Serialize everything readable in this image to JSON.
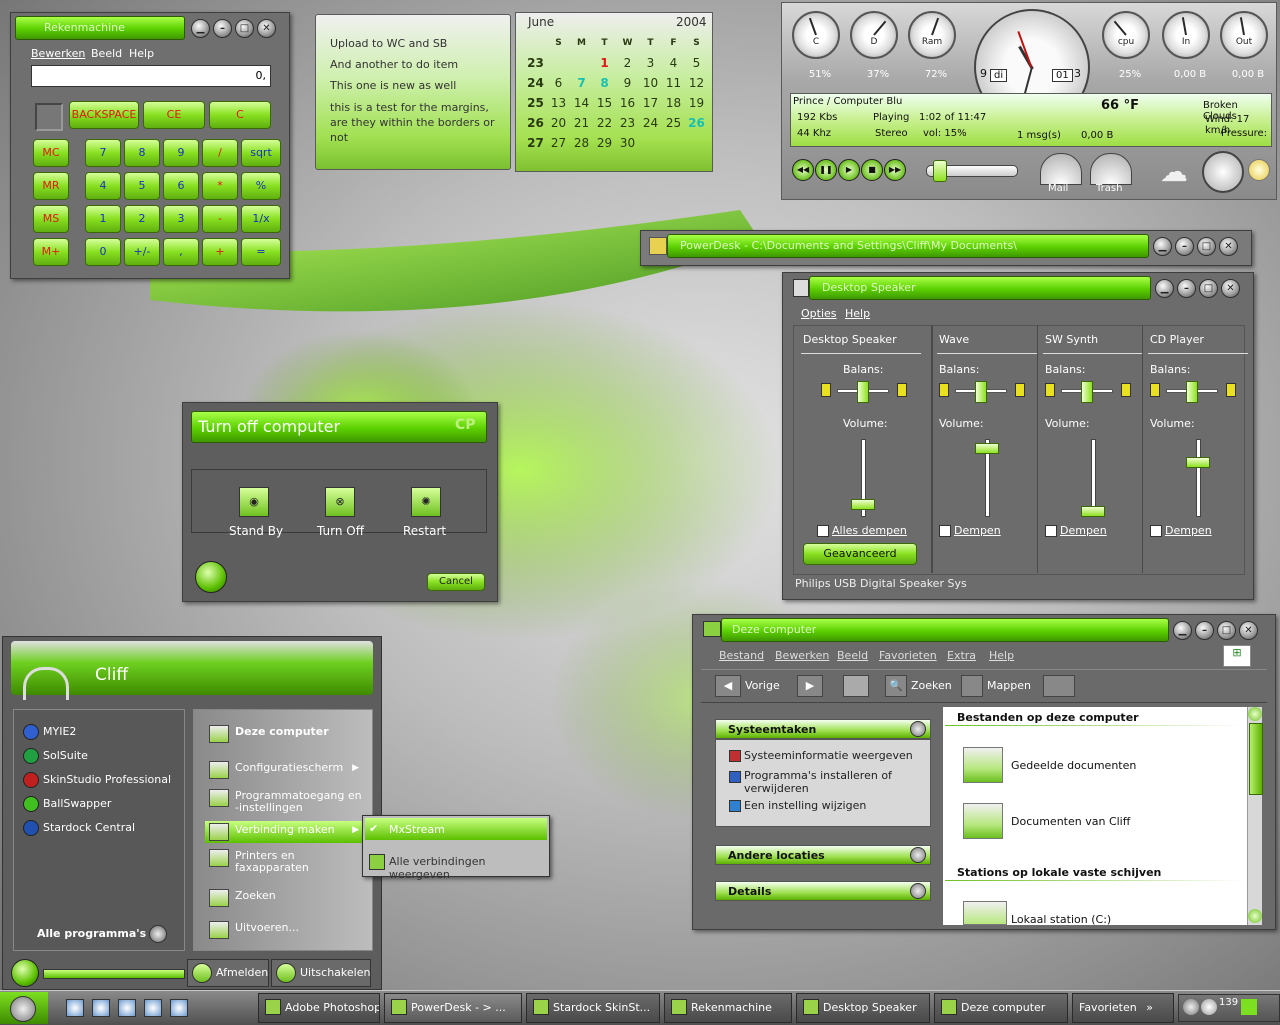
{
  "calculator": {
    "title": "Rekenmachine",
    "menu": [
      "Bewerken",
      "Beeld",
      "Help"
    ],
    "display": "0,",
    "top_buttons": [
      "BACKSPACE",
      "CE",
      "C"
    ],
    "mem_buttons": [
      "MC",
      "MR",
      "MS",
      "M+"
    ],
    "rows": [
      [
        "7",
        "8",
        "9",
        "/",
        "sqrt"
      ],
      [
        "4",
        "5",
        "6",
        "*",
        "%"
      ],
      [
        "1",
        "2",
        "3",
        "-",
        "1/x"
      ],
      [
        "0",
        "+/-",
        ",",
        "+",
        "="
      ]
    ]
  },
  "notes": {
    "lines": [
      "Upload to WC and SB",
      "And another to do item",
      "This one is new as well",
      "this is a test for the margins, are they within the borders or not"
    ]
  },
  "calendar": {
    "month": "June",
    "year": "2004",
    "weekdays": [
      "S",
      "M",
      "T",
      "W",
      "T",
      "F",
      "S"
    ],
    "weeks": [
      {
        "num": "23",
        "days": [
          "",
          "",
          "1",
          "2",
          "3",
          "4",
          "5"
        ]
      },
      {
        "num": "24",
        "days": [
          "6",
          "7",
          "8",
          "9",
          "10",
          "11",
          "12"
        ]
      },
      {
        "num": "25",
        "days": [
          "13",
          "14",
          "15",
          "16",
          "17",
          "18",
          "19"
        ]
      },
      {
        "num": "26",
        "days": [
          "20",
          "21",
          "22",
          "23",
          "24",
          "25",
          "26"
        ]
      },
      {
        "num": "27",
        "days": [
          "27",
          "28",
          "29",
          "30",
          "",
          "",
          ""
        ]
      }
    ]
  },
  "system_monitor": {
    "gauges": [
      {
        "label": "C",
        "value": "51%"
      },
      {
        "label": "D",
        "value": "37%"
      },
      {
        "label": "Ram",
        "value": "72%"
      },
      {
        "label": "cpu",
        "value": "25%"
      },
      {
        "label": "In",
        "value": "0,00 B"
      },
      {
        "label": "Out",
        "value": "0,00 B"
      }
    ],
    "clock": {
      "day": "di",
      "date": "01",
      "hour_mark_left": "9",
      "hour_mark_bottom": "6",
      "hour_mark_right": "3"
    },
    "player": {
      "track": "Prince / Computer Blu",
      "bitrate": "192 Kbs",
      "freq": "44 Khz",
      "status": "Playing",
      "mode": "Stereo",
      "time": "1:02 of 11:47",
      "volume": "vol: 15%"
    },
    "weather": {
      "temp": "66 °F",
      "cond": "Broken Clouds",
      "wind": "Wind: 17 km/h",
      "pressure": "Pressure:"
    },
    "mail": {
      "msgs": "1 msg(s)",
      "size": "0,00 B"
    },
    "icons": [
      {
        "label": "Mail"
      },
      {
        "label": "Trash"
      }
    ]
  },
  "powerdesk": {
    "title": "PowerDesk - C:\\Documents and Settings\\Cliff\\My Documents\\"
  },
  "speaker": {
    "title": "Desktop Speaker",
    "menu": [
      "Opties",
      "Help"
    ],
    "channels": [
      {
        "name": "Desktop Speaker",
        "balance": "Balans:",
        "volume": "Volume:",
        "mute": "Alles dempen",
        "level": 0.15
      },
      {
        "name": "Wave",
        "balance": "Balans:",
        "volume": "Volume:",
        "mute": "Dempen",
        "level": 0.95
      },
      {
        "name": "SW Synth",
        "balance": "Balans:",
        "volume": "Volume:",
        "mute": "Dempen",
        "level": 0.05
      },
      {
        "name": "CD Player",
        "balance": "Balans:",
        "volume": "Volume:",
        "mute": "Dempen",
        "level": 0.75
      }
    ],
    "advanced": "Geavanceerd",
    "device": "Philips USB Digital Speaker Sys"
  },
  "shutdown": {
    "title": "Turn off computer",
    "buttons": [
      "Stand By",
      "Turn Off",
      "Restart"
    ],
    "cancel": "Cancel"
  },
  "start_menu": {
    "user": "Cliff",
    "left_items": [
      "MYIE2",
      "SolSuite",
      "SkinStudio Professional",
      "BallSwapper",
      "Stardock Central"
    ],
    "all_programs": "Alle programma's",
    "right_items": [
      "Deze computer",
      "Configuratiescherm",
      "Programmatoegang en -instellingen",
      "Verbinding maken",
      "Printers en faxapparaten",
      "Zoeken",
      "Uitvoeren..."
    ],
    "submenu": [
      "MxStream",
      "Alle verbindingen weergeven"
    ],
    "logoff": "Afmelden",
    "shutdown": "Uitschakelen"
  },
  "explorer": {
    "title": "Deze computer",
    "menu": [
      "Bestand",
      "Bewerken",
      "Beeld",
      "Favorieten",
      "Extra",
      "Help"
    ],
    "toolbar": {
      "back": "Vorige",
      "search": "Zoeken",
      "folders": "Mappen"
    },
    "tasks": {
      "title": "Systeemtaken",
      "items": [
        "Systeeminformatie weergeven",
        "Programma's installeren of verwijderen",
        "Een instelling wijzigen"
      ]
    },
    "other": "Andere locaties",
    "details": "Details",
    "section1": "Bestanden op deze computer",
    "files": [
      "Gedeelde documenten",
      "Documenten van Cliff"
    ],
    "section2": "Stations op lokale vaste schijven",
    "drives": [
      "Lokaal station (C:)"
    ]
  },
  "taskbar": {
    "buttons": [
      "Adobe Photoshop",
      "PowerDesk - > ...",
      "Stardock SkinSt...",
      "Rekenmachine",
      "Desktop Speaker",
      "Deze computer"
    ],
    "favorites": "Favorieten",
    "tray_num": "139"
  }
}
